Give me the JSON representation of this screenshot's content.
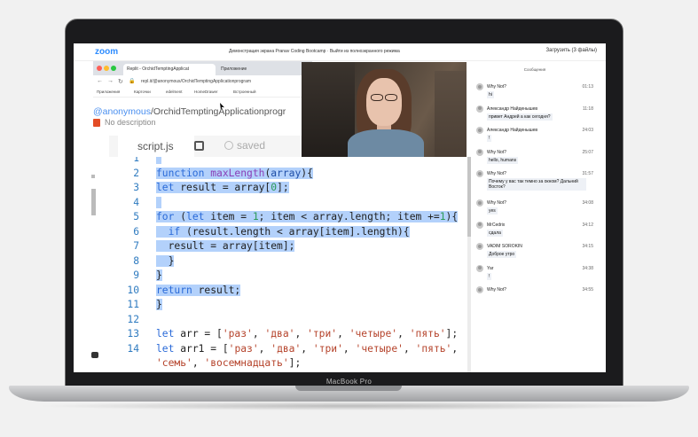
{
  "laptop": {
    "brand": "MacBook Pro"
  },
  "zoom": {
    "logo": "zoom",
    "meeting_title": "Демонстрация экрана Pranav Coding Bootcamp · Выйти из полноэкранного режима",
    "upload": "Загрузить (3 файлы)"
  },
  "browser": {
    "tabs": [
      {
        "label": "Replit - OrchidTemptingApplicat",
        "active": true
      },
      {
        "label": "Приложение",
        "active": false
      }
    ],
    "url": "repl.it/@anonymous/OrchidTemptingApplicationprogram",
    "bookmarks": [
      "Приложения",
      "Карточки",
      "edelment",
      "HomeDrawer",
      "Встроенный"
    ]
  },
  "replit": {
    "user": "@anonymous",
    "project": "/OrchidTemptingApplicationprogr",
    "description": "No description",
    "file_tab": "script.js",
    "status": "saved"
  },
  "editor": {
    "lines": [
      {
        "n": "1",
        "hl": true,
        "tokens": []
      },
      {
        "n": "2",
        "hl": true,
        "tokens": [
          [
            "kw",
            "function "
          ],
          [
            "fn",
            "maxLength"
          ],
          [
            "pl",
            "("
          ],
          [
            "var",
            "array"
          ],
          [
            "pl",
            "){"
          ]
        ]
      },
      {
        "n": "3",
        "hl": true,
        "tokens": [
          [
            "kw",
            "let "
          ],
          [
            "pl",
            "result = array["
          ],
          [
            "num",
            "0"
          ],
          [
            "pl",
            "];"
          ]
        ]
      },
      {
        "n": "4",
        "hl": true,
        "tokens": []
      },
      {
        "n": "5",
        "hl": true,
        "tokens": [
          [
            "kw",
            "for "
          ],
          [
            "pl",
            "("
          ],
          [
            "kw",
            "let "
          ],
          [
            "pl",
            "item = "
          ],
          [
            "num",
            "1"
          ],
          [
            "pl",
            "; item < array.length; item +="
          ],
          [
            "num",
            "1"
          ],
          [
            "pl",
            "){"
          ]
        ]
      },
      {
        "n": "6",
        "hl": true,
        "tokens": [
          [
            "pl",
            "  "
          ],
          [
            "kw",
            "if "
          ],
          [
            "pl",
            "(result.length < array[item].length){"
          ]
        ]
      },
      {
        "n": "7",
        "hl": true,
        "tokens": [
          [
            "pl",
            "  result = array[item];"
          ]
        ]
      },
      {
        "n": "8",
        "hl": true,
        "tokens": [
          [
            "pl",
            "  }"
          ]
        ]
      },
      {
        "n": "9",
        "hl": true,
        "tokens": [
          [
            "pl",
            "}"
          ]
        ]
      },
      {
        "n": "10",
        "hl": true,
        "tokens": [
          [
            "kw",
            "return "
          ],
          [
            "pl",
            "result;"
          ]
        ]
      },
      {
        "n": "11",
        "hl": true,
        "tokens": [
          [
            "pl",
            "}"
          ]
        ]
      },
      {
        "n": "12",
        "hl": false,
        "tokens": []
      },
      {
        "n": "13",
        "hl": false,
        "tokens": [
          [
            "kw",
            "let "
          ],
          [
            "pl",
            "arr = ["
          ],
          [
            "str",
            "'раз'"
          ],
          [
            "pl",
            ", "
          ],
          [
            "str",
            "'два'"
          ],
          [
            "pl",
            ", "
          ],
          [
            "str",
            "'три'"
          ],
          [
            "pl",
            ", "
          ],
          [
            "str",
            "'четыре'"
          ],
          [
            "pl",
            ", "
          ],
          [
            "str",
            "'пять'"
          ],
          [
            "pl",
            "];"
          ]
        ]
      },
      {
        "n": "14",
        "hl": false,
        "tokens": [
          [
            "kw",
            "let "
          ],
          [
            "pl",
            "arr1 = ["
          ],
          [
            "str",
            "'раз'"
          ],
          [
            "pl",
            ", "
          ],
          [
            "str",
            "'два'"
          ],
          [
            "pl",
            ", "
          ],
          [
            "str",
            "'три'"
          ],
          [
            "pl",
            ", "
          ],
          [
            "str",
            "'четыре'"
          ],
          [
            "pl",
            ", "
          ],
          [
            "str",
            "'пять'"
          ],
          [
            "pl",
            ","
          ]
        ]
      },
      {
        "n": "",
        "hl": false,
        "tokens": [
          [
            "str",
            "'семь'"
          ],
          [
            "pl",
            ", "
          ],
          [
            "str",
            "'восемнадцать'"
          ],
          [
            "pl",
            "];"
          ]
        ]
      }
    ]
  },
  "chat": {
    "header": "Сообщения",
    "messages": [
      {
        "sender": "Why Not?",
        "time": "01:13",
        "text": "hi"
      },
      {
        "sender": "Александр Найденышев",
        "time": "11:18",
        "text": "привет Андрей а как сегодня?"
      },
      {
        "sender": "Александр Найденышев",
        "time": "24:03",
        "text": "!"
      },
      {
        "sender": "Why Not?",
        "time": "25:07",
        "text": "hello, humans"
      },
      {
        "sender": "Why Not?",
        "time": "31:57",
        "text": "Почему у вас так темно за окном? Дальний Восток?"
      },
      {
        "sender": "Why Not?",
        "time": "34:08",
        "text": "yes"
      },
      {
        "sender": "MrCedrix",
        "time": "34:12",
        "text": "сдала"
      },
      {
        "sender": "VADIM SOROKIN",
        "time": "34:15",
        "text": "Доброе утро"
      },
      {
        "sender": "Yar",
        "time": "34:38",
        "text": "!"
      },
      {
        "sender": "Why Not?",
        "time": "34:55",
        "text": ""
      }
    ]
  }
}
